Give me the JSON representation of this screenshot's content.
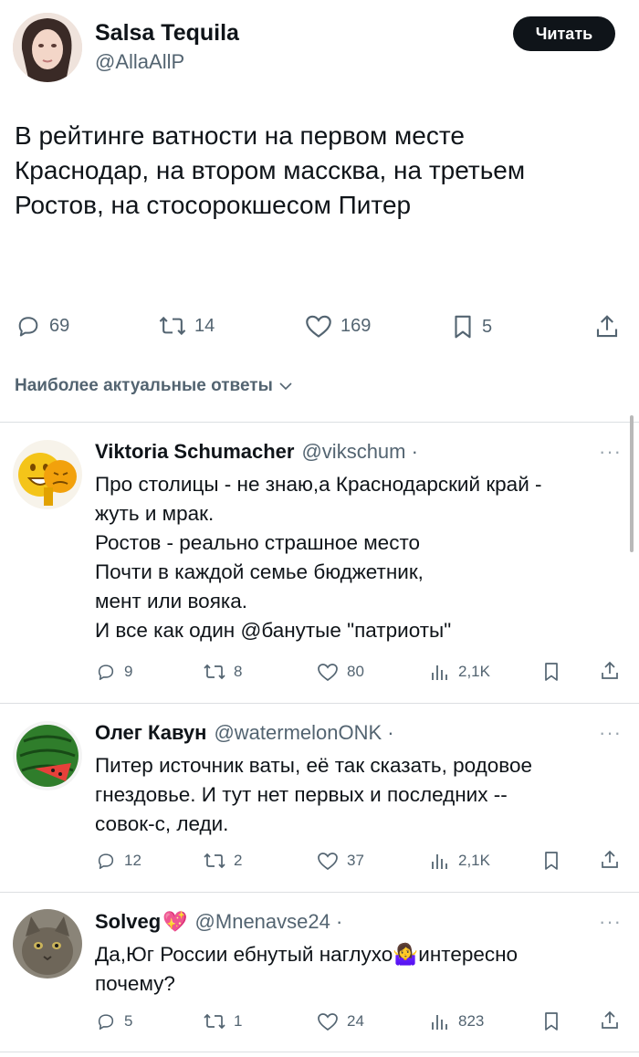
{
  "tweet": {
    "author_name": "Salsa Tequila",
    "author_handle": "@AllaAllP",
    "follow_label": "Читать",
    "text": "В рейтинге ватности на первом месте\nКраснодар, на втором массква, на третьем\nРостов, на стосорокшесом Питер",
    "stats": {
      "replies": "69",
      "reposts": "14",
      "likes": "169",
      "bookmarks": "5"
    }
  },
  "replies_sort_label": "Наиболее актуальные ответы",
  "replies": [
    {
      "name": "Viktoria Schumacher",
      "handle": "@vikschum ·",
      "text": "Про столицы - не знаю,а Краснодарский край -\nжуть и мрак.\n Ростов - реально страшное место\nПочти в каждой семье бюджетник,\nмент или вояка.\nИ все как один @банутые \"патриоты\"",
      "replies": "9",
      "reposts": "8",
      "likes": "80",
      "views": "2,1K"
    },
    {
      "name": "Олег Кавун",
      "handle": "@watermelonONK ·",
      "text": "Питер источник ваты, её так сказать, родовое\nгнездовье. И тут нет первых и последних --\nсовок-с, леди.",
      "replies": "12",
      "reposts": "2",
      "likes": "37",
      "views": "2,1K"
    },
    {
      "name": "Solveg",
      "name_emoji": "💖",
      "handle": "@Mnenavse24 ·",
      "text": "Да,Юг России ебнутый наглухо🤷‍♀️интересно\nпочему?",
      "replies": "5",
      "reposts": "1",
      "likes": "24",
      "views": "823"
    }
  ],
  "icons": [
    "reply-icon",
    "repost-icon",
    "like-icon",
    "bookmark-icon",
    "share-icon",
    "views-icon",
    "more-icon",
    "chevron-down-icon"
  ],
  "colors": {
    "text": "#0f1419",
    "muted": "#536471",
    "divider": "#dcdfe2",
    "button": "#0f1419"
  }
}
